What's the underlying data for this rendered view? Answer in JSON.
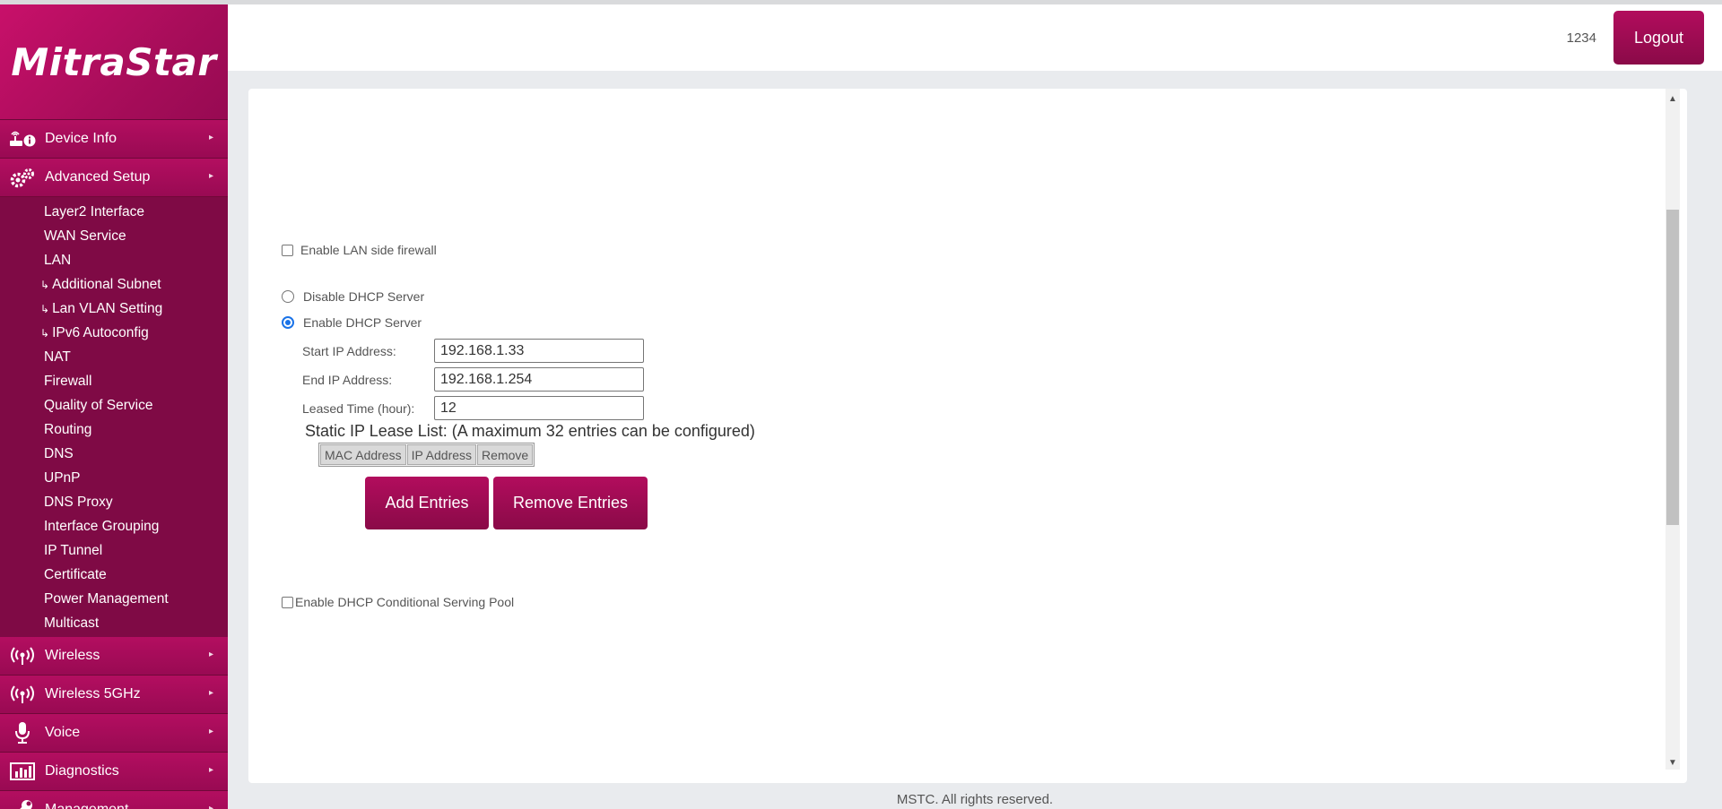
{
  "brand": {
    "logo": "MitraStar"
  },
  "header": {
    "user": "1234",
    "logout_label": "Logout"
  },
  "sidebar": {
    "device_info": "Device Info",
    "advanced_setup": "Advanced Setup",
    "advanced_items": [
      "Layer2 Interface",
      "WAN Service",
      "LAN",
      "Additional Subnet",
      "Lan VLAN Setting",
      "IPv6 Autoconfig",
      "NAT",
      "Firewall",
      "Quality of Service",
      "Routing",
      "DNS",
      "UPnP",
      "DNS Proxy",
      "Interface Grouping",
      "IP Tunnel",
      "Certificate",
      "Power Management",
      "Multicast"
    ],
    "wireless": "Wireless",
    "wireless_5g": "Wireless 5GHz",
    "voice": "Voice",
    "diagnostics": "Diagnostics",
    "management": "Management",
    "sub_hook": "↳",
    "arrow": "▸"
  },
  "lan": {
    "enable_firewall_label": "Enable LAN side firewall",
    "disable_dhcp_label": "Disable DHCP Server",
    "enable_dhcp_label": "Enable DHCP Server",
    "start_ip_label": "Start IP Address:",
    "start_ip_value": "192.168.1.33",
    "end_ip_label": "End IP Address:",
    "end_ip_value": "192.168.1.254",
    "lease_label": "Leased Time (hour):",
    "lease_value": "12",
    "static_lease_title": "Static IP Lease List: (A maximum 32 entries can be configured)",
    "lease_columns": [
      "MAC Address",
      "IP Address",
      "Remove"
    ],
    "add_entries_label": "Add Entries",
    "remove_entries_label": "Remove Entries",
    "conditional_pool_label": "Enable DHCP Conditional Serving Pool",
    "firewall_enabled": false,
    "dhcp_enabled": true,
    "conditional_pool_enabled": false
  },
  "footer": {
    "copyright": "MSTC. All rights reserved."
  },
  "colors": {
    "brand": "#990a53",
    "brand_dark": "#7f0a45",
    "radio_accent": "#1a73e8"
  },
  "icons": {
    "device_info": "device-info-icon",
    "advanced_setup": "gears-icon",
    "wireless": "wifi-icon",
    "voice": "microphone-icon",
    "diagnostics": "chart-icon",
    "management": "wrench-icon"
  }
}
